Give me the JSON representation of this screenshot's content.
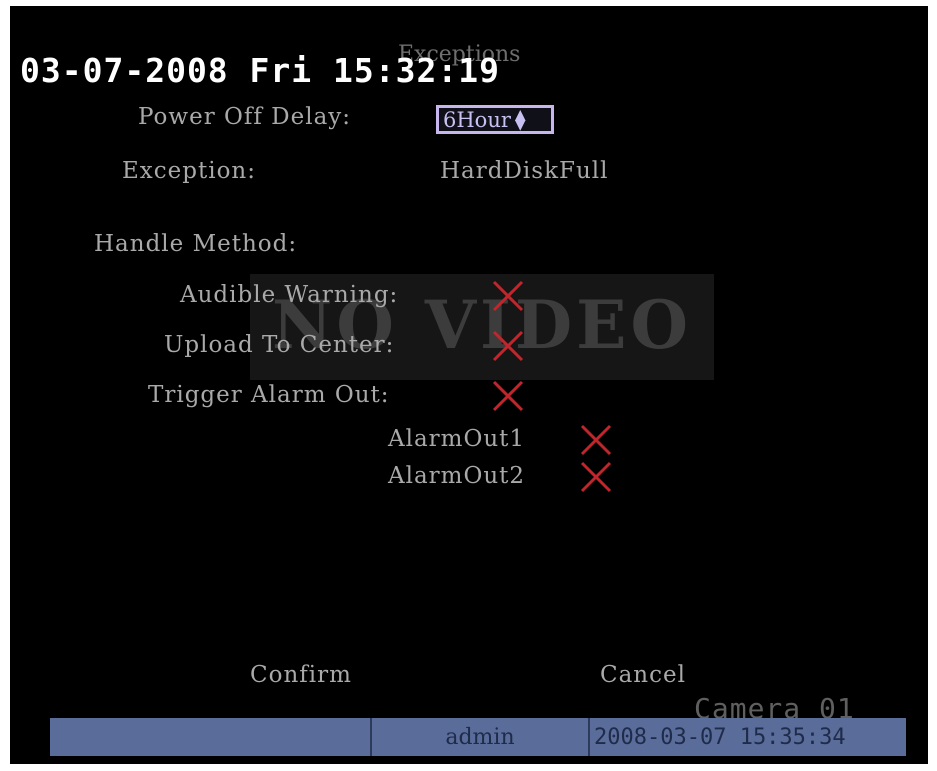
{
  "osd": {
    "datetime": "03-07-2008 Fri 15:32:19",
    "dialog_title": "Exceptions",
    "camera_name": "Camera 01",
    "no_video_text": "NO VIDEO"
  },
  "form": {
    "power_off_delay_label": "Power Off Delay:",
    "power_off_delay_value": "6Hour",
    "exception_label": "Exception:",
    "exception_value": "HardDiskFull",
    "handle_method_label": "Handle Method:",
    "audible_warning_label": "Audible Warning:",
    "upload_to_center_label": "Upload To Center:",
    "trigger_alarm_out_label": "Trigger Alarm Out:",
    "alarm_out_1_label": "AlarmOut1",
    "alarm_out_2_label": "AlarmOut2"
  },
  "checks": {
    "audible_warning": false,
    "upload_to_center": false,
    "trigger_alarm_out": false,
    "alarm_out_1": false,
    "alarm_out_2": false
  },
  "buttons": {
    "confirm_label": "Confirm",
    "cancel_label": "Cancel"
  },
  "statusbar": {
    "user": "admin",
    "timestamp": "2008-03-07 15:35:34"
  },
  "icons": {
    "unchecked": "x-mark-icon",
    "spinner": "up-down-arrow-icon"
  },
  "colors": {
    "x_mark": "#c0262c",
    "statusbar": "#5a6c99",
    "select_border": "#c7b6ee"
  }
}
